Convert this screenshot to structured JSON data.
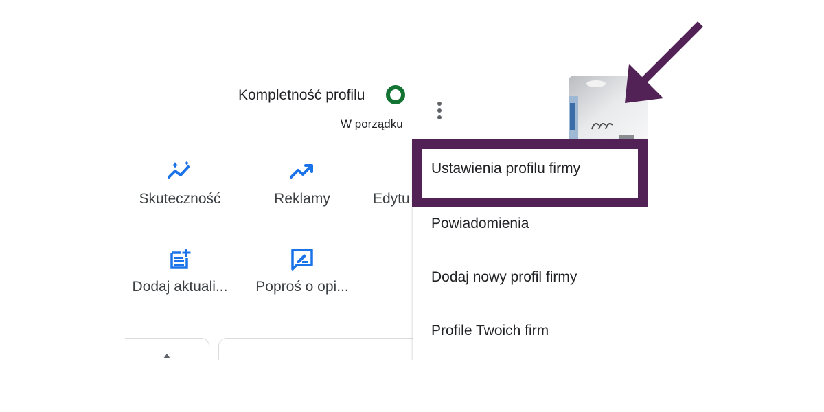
{
  "profile": {
    "completeness_label": "Kompletność profilu",
    "completeness_status": "W porządku"
  },
  "actions": [
    {
      "label": "Skuteczność",
      "icon": "performance-sparkle-icon"
    },
    {
      "label": "Reklamy",
      "icon": "trending-up-icon"
    },
    {
      "label": "Edytu",
      "icon": "edit-icon"
    },
    {
      "label": "Dodaj aktuali...",
      "icon": "post-add-icon"
    },
    {
      "label": "Poproś o opi...",
      "icon": "rate-review-icon"
    }
  ],
  "menu": {
    "items": [
      {
        "label": "Ustawienia profilu firmy"
      },
      {
        "label": "Powiadomienia"
      },
      {
        "label": "Dodaj nowy profil firmy"
      },
      {
        "label": "Profile Twoich firm"
      }
    ]
  },
  "colors": {
    "accent_blue": "#1a73e8",
    "status_green": "#137333",
    "annotation_purple": "#522256"
  }
}
